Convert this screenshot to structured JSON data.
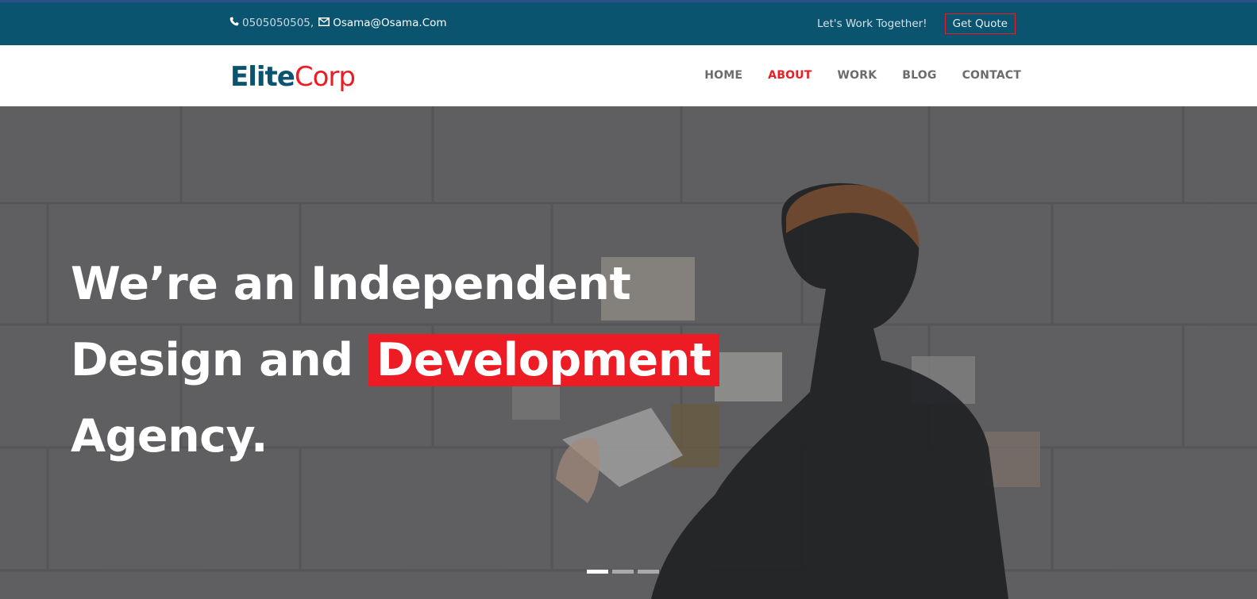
{
  "topbar": {
    "phone": "0505050505,",
    "email": "Osama@Osama.Com",
    "tagline": "Let's Work Together!",
    "quote_label": "Get Quote",
    "phone_icon": "phone-icon",
    "mail_icon": "envelope-icon"
  },
  "logo": {
    "part1": "Elite",
    "part2": "Corp"
  },
  "nav": {
    "items": [
      {
        "label": "HOME"
      },
      {
        "label": "ABOUT",
        "active": true
      },
      {
        "label": "WORK"
      },
      {
        "label": "BLOG"
      },
      {
        "label": "CONTACT"
      }
    ]
  },
  "hero": {
    "line1": "We’re an Independent",
    "line2_text": "Design and ",
    "line2_highlight": "Development",
    "line3": "Agency.",
    "slides": {
      "count": 3,
      "active": 1
    }
  },
  "colors": {
    "brand_blue": "#0a5470",
    "accent_red": "#ed1c24",
    "nav_text": "#6b6b6b"
  }
}
